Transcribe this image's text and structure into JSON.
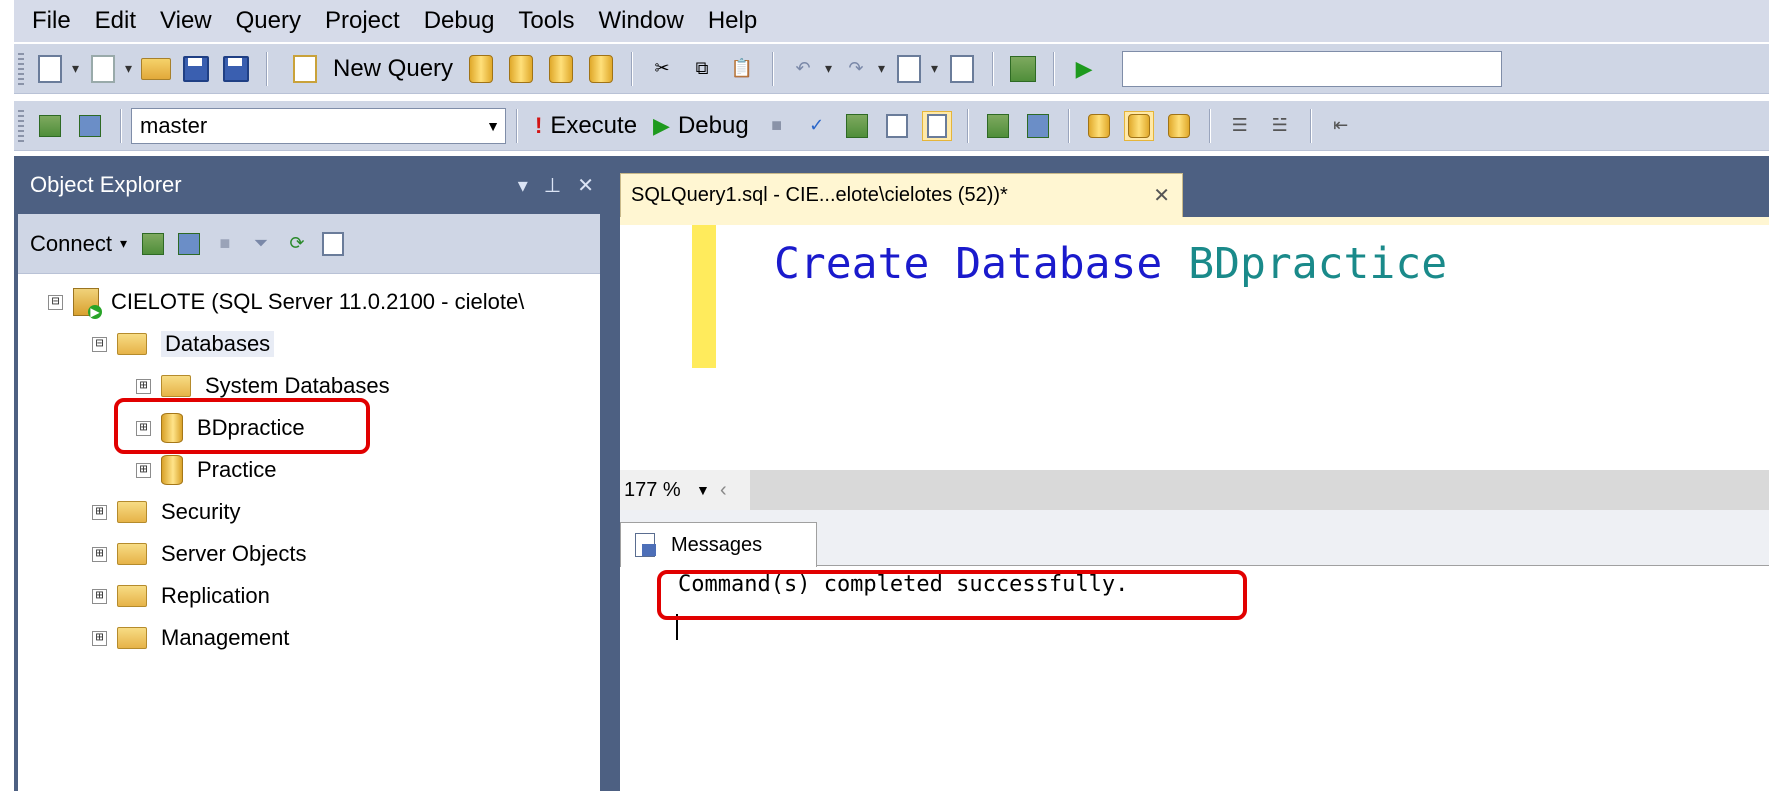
{
  "menu": [
    "File",
    "Edit",
    "View",
    "Query",
    "Project",
    "Debug",
    "Tools",
    "Window",
    "Help"
  ],
  "toolbar1": {
    "new_query_label": "New Query"
  },
  "toolbar2": {
    "database": "master",
    "execute_label": "Execute",
    "debug_label": "Debug"
  },
  "object_explorer": {
    "title": "Object Explorer",
    "connect_label": "Connect",
    "tree": [
      {
        "label": "CIELOTE (SQL Server 11.0.2100 - cielote\\",
        "icon": "server-icon",
        "expander": "⊟"
      },
      {
        "label": "Databases",
        "icon": "folder-icon",
        "expander": "⊟"
      },
      {
        "label": "System Databases",
        "icon": "folder-icon",
        "expander": "⊞"
      },
      {
        "label": "BDpractice",
        "icon": "database-icon",
        "expander": "⊞"
      },
      {
        "label": "Practice",
        "icon": "database-icon",
        "expander": "⊞"
      },
      {
        "label": "Security",
        "icon": "folder-icon",
        "expander": "⊞"
      },
      {
        "label": "Server Objects",
        "icon": "folder-icon",
        "expander": "⊞"
      },
      {
        "label": "Replication",
        "icon": "folder-icon",
        "expander": "⊞"
      },
      {
        "label": "Management",
        "icon": "folder-icon",
        "expander": "⊞"
      }
    ]
  },
  "editor": {
    "tab_title": "SQLQuery1.sql - CIE...elote\\cielotes (52))*",
    "code_keyword": "Create Database",
    "code_identifier": "BDpractice",
    "zoom": "177 %"
  },
  "results": {
    "tab_label": "Messages",
    "message": "Command(s) completed successfully."
  },
  "colors": {
    "highlight_box": "#e10000",
    "panel_title": "#4d6082",
    "keyword": "#1a1acc",
    "identifier": "#1a8a8a"
  }
}
